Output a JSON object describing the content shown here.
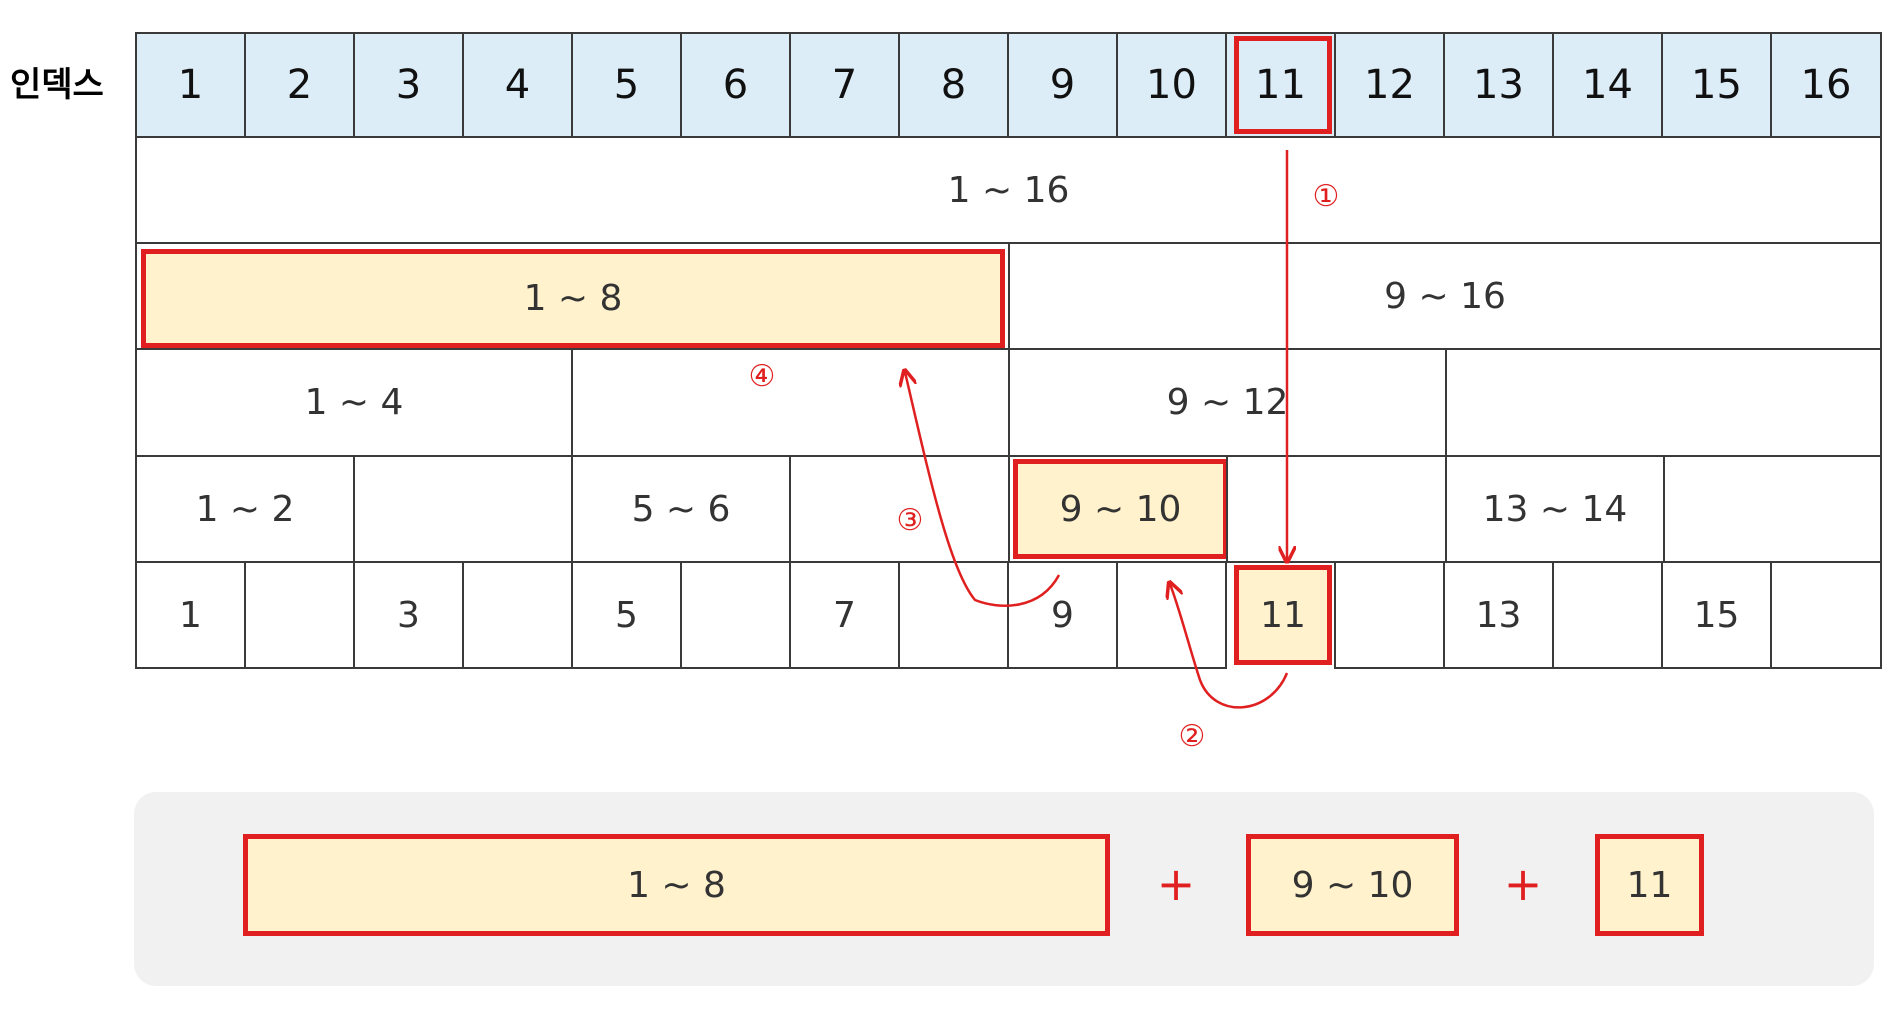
{
  "index_label": "인덱스",
  "index_cells": [
    "1",
    "2",
    "3",
    "4",
    "5",
    "6",
    "7",
    "8",
    "9",
    "10",
    "11",
    "12",
    "13",
    "14",
    "15",
    "16"
  ],
  "level1": [
    "1 ~ 16"
  ],
  "level2": [
    "1 ~ 8",
    "9 ~ 16"
  ],
  "level3": [
    "1 ~ 4",
    "",
    "9 ~ 12",
    ""
  ],
  "level4": [
    "1 ~ 2",
    "",
    "5 ~ 6",
    "",
    "9 ~ 10",
    "",
    "13 ~ 14",
    ""
  ],
  "level5": [
    "1",
    "",
    "3",
    "",
    "5",
    "",
    "7",
    "",
    "9",
    "",
    "11",
    "",
    "13",
    "",
    "15",
    ""
  ],
  "steps": [
    "①",
    "②",
    "③",
    "④"
  ],
  "summary": {
    "parts": [
      "1 ~ 8",
      "9 ~ 10",
      "11"
    ],
    "plus": "+"
  },
  "colors": {
    "index_bg": "#dcedf8",
    "highlight_bg": "#fff2cc",
    "accent_red": "#e02020",
    "panel_bg": "#f1f1f1"
  }
}
